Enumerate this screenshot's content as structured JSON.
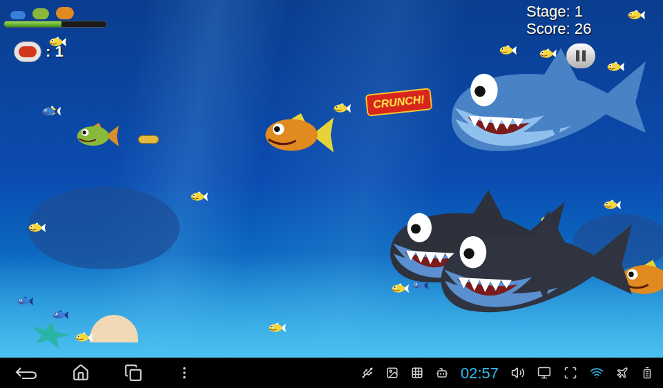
{
  "hud": {
    "progress": {
      "level": 0.56
    },
    "lives": ": 1",
    "stage": "Stage: 1",
    "score": "Score: 26"
  },
  "effects": [
    {
      "text": "CRUNCH!"
    }
  ],
  "status_bar": {
    "time": "02:57"
  }
}
